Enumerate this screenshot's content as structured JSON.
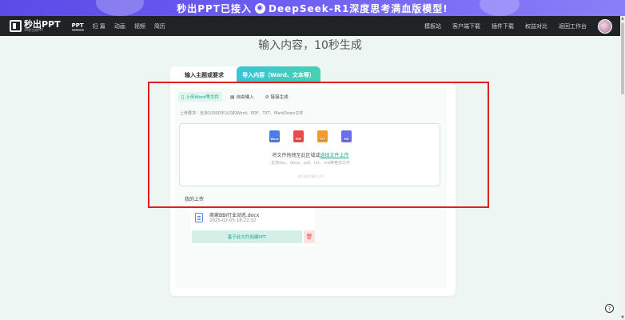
{
  "promo": {
    "text_before": "秒出PPT已接入",
    "text_after": "DeepSeek-R1深度思考满血版模型!"
  },
  "nav": {
    "logo_main": "秒出PPT",
    "logo_sub": "10秒生成PPT",
    "left_links": [
      "PPT",
      "妇 篇",
      "动画",
      "视频",
      "简历"
    ],
    "right_links": [
      "模板站",
      "客户端下载",
      "插件下载",
      "权益对比",
      "返回工作台"
    ]
  },
  "headline": "输入内容，10秒生成",
  "tabs": {
    "topic": "输入主题或要求",
    "content": "导入内容（Word、文本等）"
  },
  "subtabs": {
    "upload_word": "上传Word等文件",
    "free_input": "自由输入",
    "link_gen": "链接生成"
  },
  "requirement": "上传要求：支持10000字以内的Word、PDF、TXT、MarkDown文件",
  "dropzone": {
    "filetypes": [
      "Word",
      "PDF",
      "TXT",
      "MD"
    ],
    "text_prefix": "将文件拖拽至此区域或",
    "link": "选择文件上传",
    "support": "支持doc、docx、pdf、txt、md等格式文件",
    "note": "图片和扫描件上传"
  },
  "my_uploads_label": "我的上传",
  "uploaded_file": {
    "name": "商家BBI行业动态.docx",
    "date": "2025-02-05 18:22:32",
    "generate_label": "基于此文件创建PPT",
    "delete_icon": "trash-icon"
  },
  "colors": {
    "accent": "#1aa889",
    "highlight": "#e02020",
    "nav_bg": "#1f2326",
    "promo": "#5b4be8"
  }
}
